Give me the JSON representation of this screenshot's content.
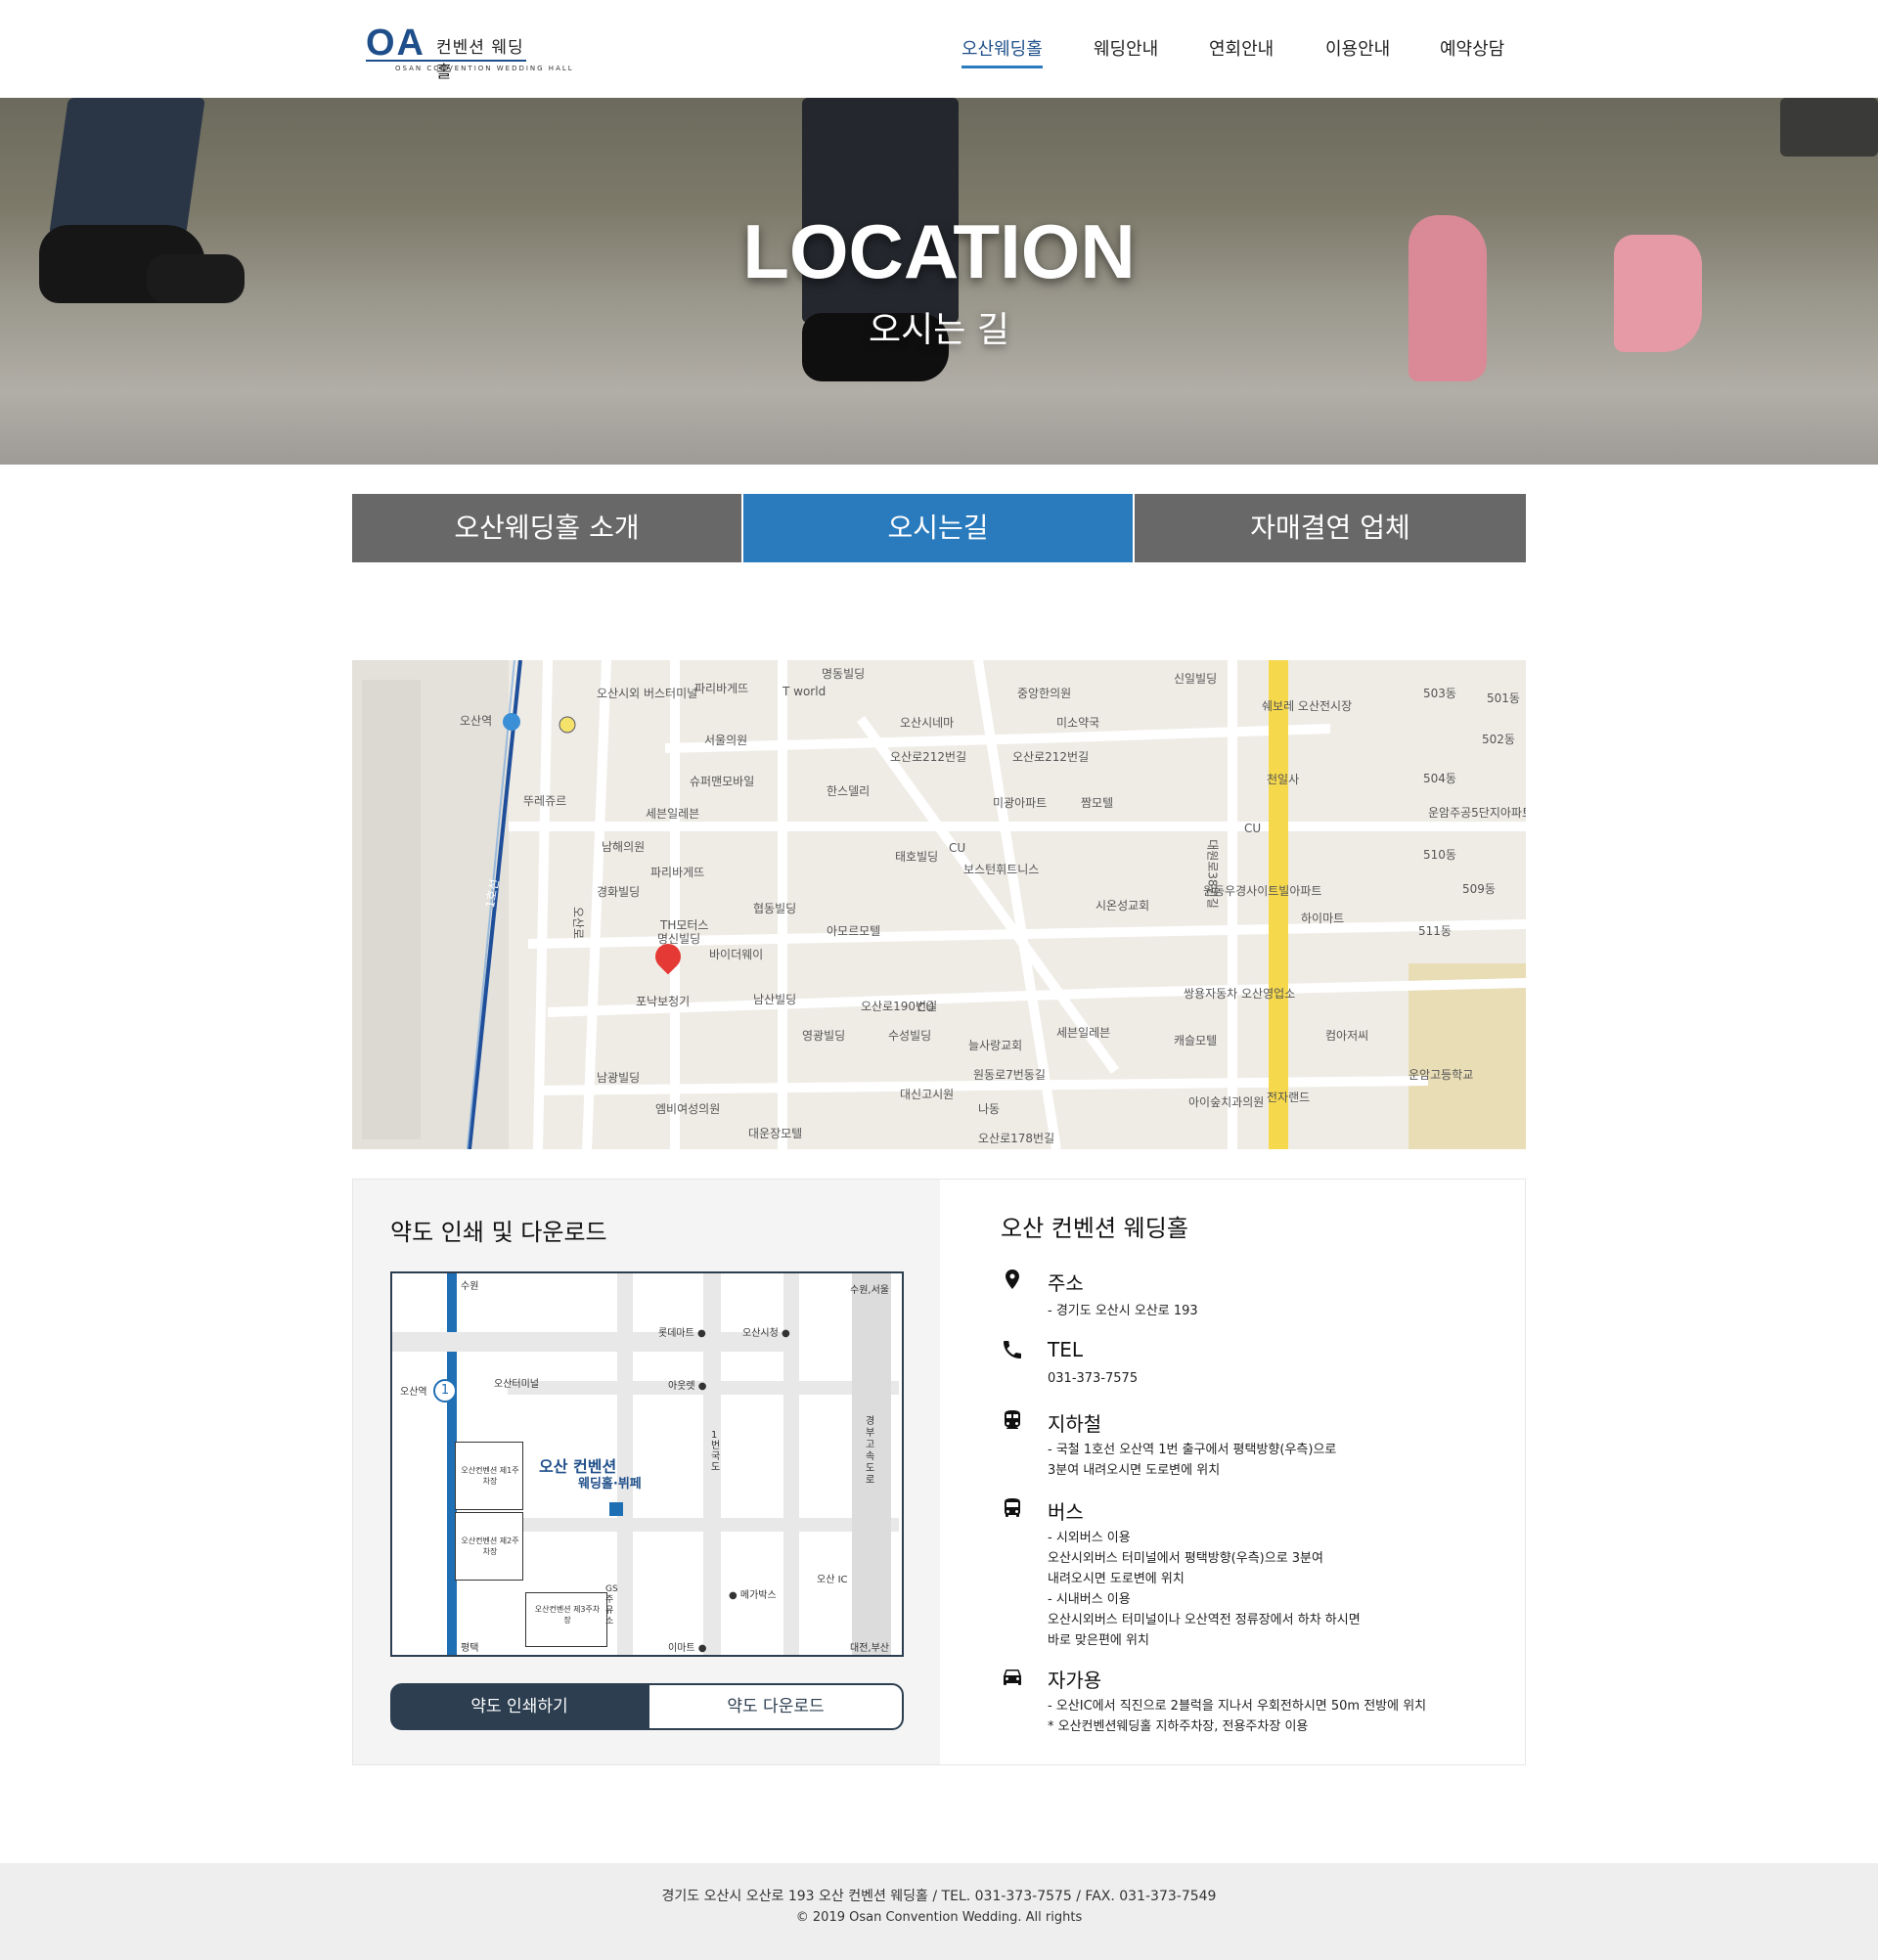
{
  "header": {
    "logo": {
      "mark": "OA",
      "name": "컨벤션 웨딩홀",
      "subtitle": "OSAN CONVENTION WEDDING HALL"
    },
    "nav": [
      {
        "label": "오산웨딩홀",
        "active": true
      },
      {
        "label": "웨딩안내",
        "active": false
      },
      {
        "label": "연회안내",
        "active": false
      },
      {
        "label": "이용안내",
        "active": false
      },
      {
        "label": "예약상담",
        "active": false
      }
    ]
  },
  "hero": {
    "title": "LOCATION",
    "subtitle": "오시는 길"
  },
  "tabs": [
    {
      "label": "오산웨딩홀 소개",
      "active": false
    },
    {
      "label": "오시는길",
      "active": true
    },
    {
      "label": "자매결연 업체",
      "active": false
    }
  ],
  "map": {
    "labels": [
      "명동빌딩",
      "신일빌딩",
      "오산시외 버스터미널",
      "파리바게뜨",
      "T world",
      "중앙한의원",
      "쉐보레 오산전시장",
      "503동",
      "501동",
      "오산역",
      "서울의원",
      "오산시네마",
      "미소약국",
      "502동",
      "오산로212번길",
      "오산로212번길",
      "슈퍼맨모바일",
      "한스델리",
      "천일사",
      "504동",
      "세븐일레븐",
      "뚜레쥬르",
      "미광아파트",
      "짬모텔",
      "CU",
      "운암주공5단지아파트",
      "남해의원",
      "파리바게뜨",
      "태호빌딩",
      "CU",
      "보스턴휘트니스",
      "510동",
      "경화빌딩",
      "협동빌딩",
      "시온성교회",
      "원동우경사이트빌아파트",
      "하이마트",
      "509동",
      "TH모터스",
      "아모르모텔",
      "511동",
      "바이더웨이",
      "명신빌딩",
      "쌍용자동차 오산영업소",
      "포낙보청기",
      "남산빌딩",
      "오산로190번길",
      "CU",
      "영광빌딩",
      "수성빌딩",
      "늘사랑교회",
      "세븐일레븐",
      "캐슬모텔",
      "컴아저씨",
      "운암고등학교",
      "남광빌딩",
      "원동로7번동길",
      "대신고시원",
      "엠비여성의원",
      "아이숲치과의원",
      "전자랜드",
      "나동",
      "대운장모텔",
      "오산로178번길",
      "1호선",
      "대원로38번길",
      "오산로"
    ]
  },
  "directions": {
    "title": "약도 인쇄 및 다운로드",
    "map_labels": {
      "top_left": "수원",
      "top_right": "수원,서울",
      "station": "오산역",
      "line_no": "1",
      "lotte": "롯데마트 ●",
      "city_hall": "오산시청 ●",
      "terminal": "오산터미널",
      "outlet": "아웃렛 ●",
      "national_road": "1번국도",
      "expressway": "경부고속도로",
      "parking1": "오산컨벤션 제1주차장",
      "parking2": "오산컨벤션 제2주차장",
      "parking3": "오산컨벤션 제3주차장",
      "hall_name": "오산 컨벤션",
      "hall_sub": "웨딩홀·뷔페",
      "osan_ic": "오산 IC",
      "megabox": "● 메가박스",
      "gs": "GS주유소",
      "emart": "이마트 ●",
      "bottom_left": "평택",
      "bottom_right": "대전,부산"
    },
    "print_button": "약도 인쇄하기",
    "download_button": "약도 다운로드"
  },
  "info": {
    "title": "오산 컨벤션 웨딩홀",
    "items": [
      {
        "icon": "map-pin-icon",
        "heading": "주소",
        "text": "- 경기도 오산시 오산로 193"
      },
      {
        "icon": "phone-icon",
        "heading": "TEL",
        "text": "031-373-7575"
      },
      {
        "icon": "subway-icon",
        "heading": "지하철",
        "text": "- 국철 1호선 오산역 1번 출구에서 평택방향(우측)으로\n3분여 내려오시면 도로변에 위치"
      },
      {
        "icon": "bus-icon",
        "heading": "버스",
        "text": "- 시외버스 이용\n오산시외버스 터미널에서 평택방향(우측)으로 3분여\n내려오시면 도로변에 위치\n- 시내버스 이용\n오산시외버스 터미널이나 오산역전 정류장에서 하차 하시면\n바로 맞은편에 위치"
      },
      {
        "icon": "car-icon",
        "heading": "자가용",
        "text": "- 오산IC에서 직진으로 2블럭을 지나서 우회전하시면 50m 전방에 위치\n* 오산컨벤션웨딩홀 지하주차장, 전용주차장 이용"
      }
    ]
  },
  "footer": {
    "line1": "경기도 오산시 오산로 193 오산 컨벤션 웨딩홀 / TEL. 031-373-7575 / FAX. 031-373-7549",
    "line2": "© 2019 Osan Convention Wedding. All rights"
  }
}
